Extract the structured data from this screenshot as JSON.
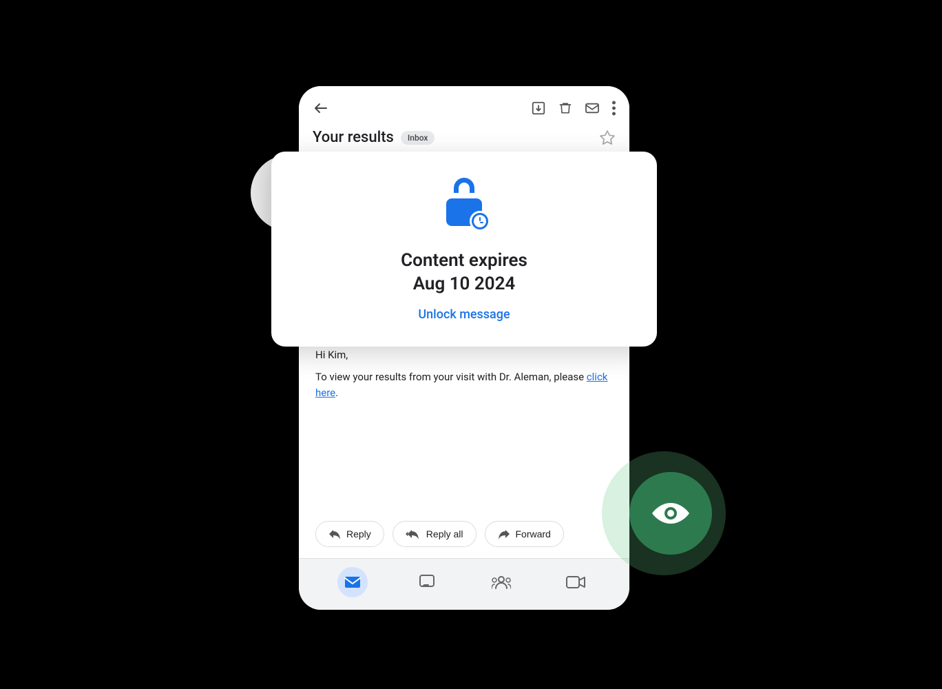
{
  "scene": {
    "background": "#000000"
  },
  "email": {
    "toolbar": {
      "back_label": "←",
      "download_icon": "download",
      "delete_icon": "trash",
      "mark_read_icon": "envelope",
      "more_icon": "more-vert"
    },
    "subject": "Your results",
    "inbox_badge": "Inbox",
    "star_icon": "star-outline",
    "body": {
      "greeting": "Hi Kim,",
      "text": "To view your results from your visit with Dr. Aleman, please ",
      "link_text": "click here",
      "link_suffix": "."
    }
  },
  "expiry_card": {
    "title_line1": "Content expires",
    "title_line2": "Aug 10 2024",
    "unlock_label": "Unlock message"
  },
  "reply_buttons": [
    {
      "id": "reply",
      "icon": "reply",
      "label": "Reply"
    },
    {
      "id": "reply-all",
      "icon": "reply-all",
      "label": "Reply all"
    },
    {
      "id": "forward",
      "icon": "forward",
      "label": "Forward"
    }
  ],
  "bottom_nav": [
    {
      "id": "mail",
      "icon": "mail",
      "active": true
    },
    {
      "id": "chat",
      "icon": "chat",
      "active": false
    },
    {
      "id": "spaces",
      "icon": "groups",
      "active": false
    },
    {
      "id": "meet",
      "icon": "video",
      "active": false
    }
  ]
}
